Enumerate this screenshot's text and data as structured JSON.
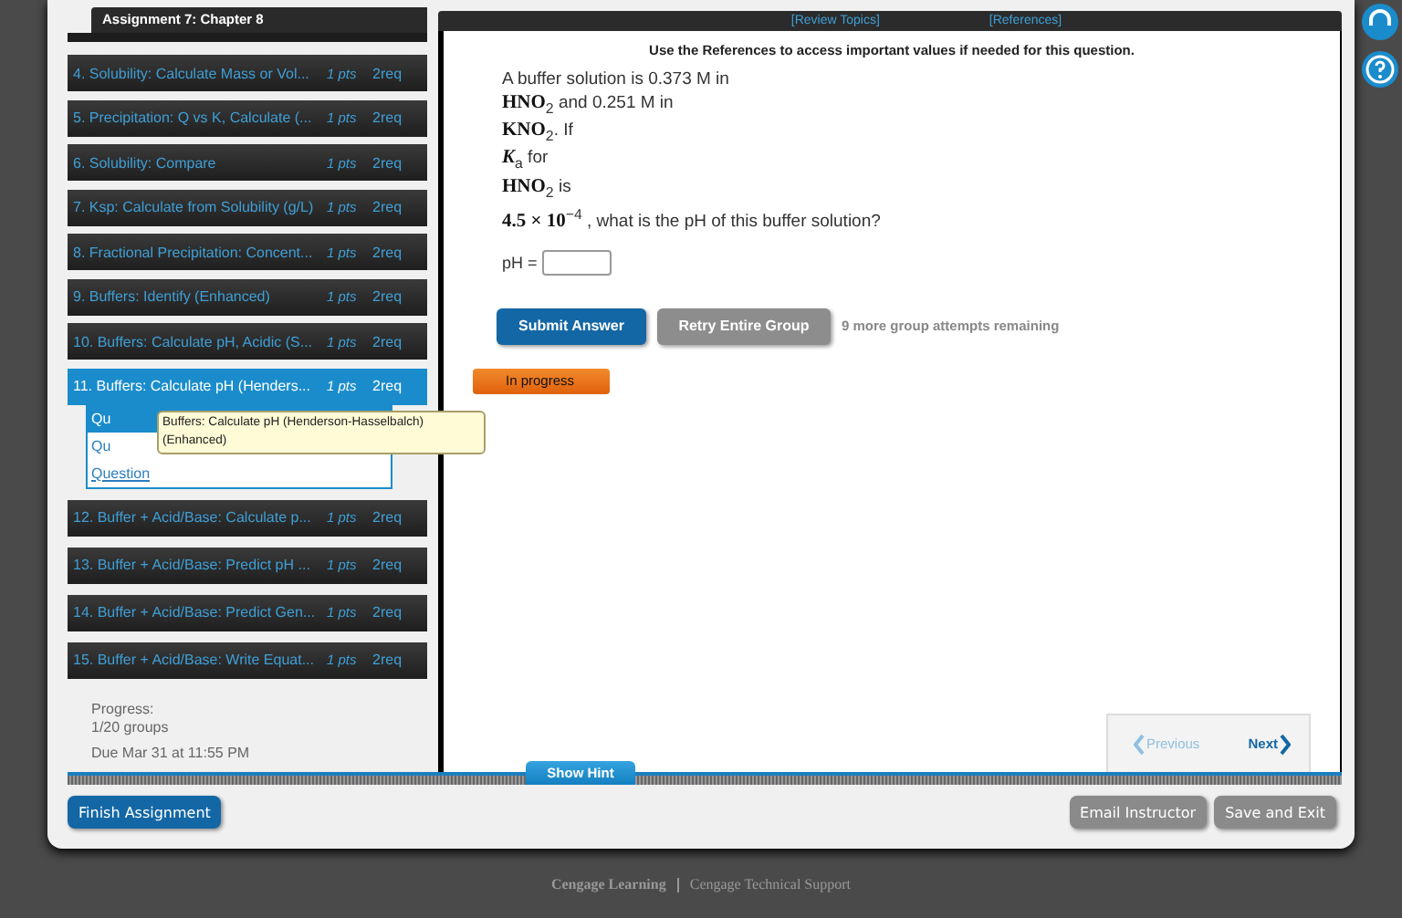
{
  "assignment_title": "Assignment 7: Chapter 8",
  "questions": [
    {
      "label": "4. Solubility: Calculate Mass or Vol...",
      "points": "1 pts",
      "requirement": "2req",
      "selected": false
    },
    {
      "label": "5. Precipitation: Q vs K, Calculate (...",
      "points": "1 pts",
      "requirement": "2req",
      "selected": false
    },
    {
      "label": "6. Solubility: Compare",
      "points": "1 pts",
      "requirement": "2req",
      "selected": false
    },
    {
      "label": "7. Ksp: Calculate from Solubility (g/L)",
      "points": "1 pts",
      "requirement": "2req",
      "selected": false
    },
    {
      "label": "8. Fractional Precipitation: Concent...",
      "points": "1 pts",
      "requirement": "2req",
      "selected": false
    },
    {
      "label": "9. Buffers: Identify (Enhanced)",
      "points": "1 pts",
      "requirement": "2req",
      "selected": false
    },
    {
      "label": "10. Buffers: Calculate pH, Acidic (S...",
      "points": "1 pts",
      "requirement": "2req",
      "selected": false
    },
    {
      "label": "11. Buffers: Calculate pH (Henders...",
      "points": "1 pts",
      "requirement": "2req",
      "selected": true,
      "status": "In progress",
      "parts": [
        {
          "label": "Qu",
          "selected": true
        },
        {
          "label": "Qu",
          "selected": false
        },
        {
          "label": "Question",
          "selected": false
        }
      ]
    },
    {
      "label": "12. Buffer + Acid/Base: Calculate p...",
      "points": "1 pts",
      "requirement": "2req",
      "selected": false
    },
    {
      "label": "13. Buffer + Acid/Base: Predict pH ...",
      "points": "1 pts",
      "requirement": "2req",
      "selected": false
    },
    {
      "label": "14. Buffer + Acid/Base: Predict Gen...",
      "points": "1 pts",
      "requirement": "2req",
      "selected": false
    },
    {
      "label": "15. Buffer + Acid/Base: Write Equat...",
      "points": "1 pts",
      "requirement": "2req",
      "selected": false
    }
  ],
  "tooltip": "Buffers: Calculate pH (Henderson-Hasselbalch) (Enhanced)",
  "progress": {
    "label": "Progress:",
    "value": "1/20 groups",
    "due": "Due Mar 31 at 11:55 PM"
  },
  "top_links": [
    "[Review Topics]",
    "[References]"
  ],
  "instruction": "Use the References to access important values if needed for this question.",
  "question_lines": [
    "A buffer solution is 0.373 M in",
    "**HNO**$_{2}$ and 0.251 M in",
    "**KNO**$_{2}$. If",
    "*K*$_{a}$ for",
    "**HNO**$_{2}$ is",
    "**4.5 × 10**$^{−4}$ , what is the pH of this buffer solution?"
  ],
  "answer": {
    "label": "pH ="
  },
  "actions": {
    "submit": "Submit Answer",
    "retry": "Retry Entire Group",
    "attempts": "9 more group attempts remaining"
  },
  "show_hint": "Show Hint",
  "navigation": [
    {
      "label": "Previous",
      "disabled": true
    },
    {
      "label": "Next",
      "disabled": false
    }
  ],
  "footer_buttons": [
    {
      "label": "Finish Assignment",
      "kind": "primary"
    },
    {
      "label": "Email Instructor",
      "kind": "secondary"
    },
    {
      "label": "Save and Exit",
      "kind": "secondary"
    }
  ],
  "page_footer": [
    "Cengage Learning",
    "Cengage Technical Support"
  ]
}
